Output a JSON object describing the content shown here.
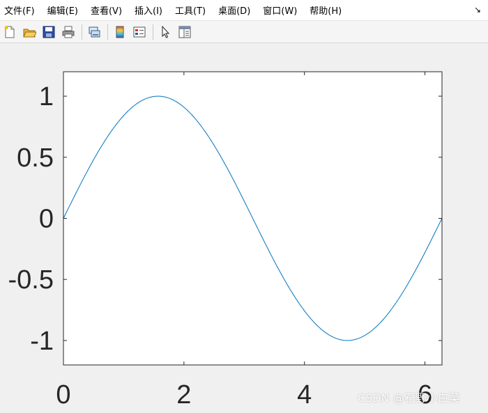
{
  "menubar": {
    "items": [
      "文件(F)",
      "编辑(E)",
      "查看(V)",
      "插入(I)",
      "工具(T)",
      "桌面(D)",
      "窗口(W)",
      "帮助(H)"
    ],
    "arrow_icon": "dock-arrow-icon"
  },
  "toolbar": {
    "icons": [
      "new-figure-icon",
      "open-file-icon",
      "save-icon",
      "print-icon",
      "link-plot-icon",
      "colorbar-icon",
      "legend-icon",
      "pointer-icon",
      "property-editor-icon"
    ]
  },
  "watermark": "CSDN @石野小白菜",
  "chart_data": {
    "type": "line",
    "function": "sin(x)",
    "xlim": [
      0,
      6.283
    ],
    "ylim": [
      -1.2,
      1.2
    ],
    "x_ticks": [
      0,
      2,
      4,
      6
    ],
    "x_tick_labels": [
      "0",
      "2",
      "4",
      "6"
    ],
    "y_ticks": [
      -1,
      -0.5,
      0,
      0.5,
      1
    ],
    "y_tick_labels": [
      "-1",
      "-0.5",
      "0",
      "0.5",
      "1"
    ],
    "series": [
      {
        "color": "#0072bd",
        "x": [
          0,
          0.3142,
          0.6283,
          0.9425,
          1.2566,
          1.5708,
          1.885,
          2.1991,
          2.5133,
          2.8274,
          3.1416,
          3.4558,
          3.7699,
          4.0841,
          4.3982,
          4.7124,
          5.0265,
          5.3407,
          5.6549,
          5.969,
          6.2832
        ],
        "y": [
          0,
          0.309,
          0.5878,
          0.809,
          0.9511,
          1,
          0.9511,
          0.809,
          0.5878,
          0.309,
          0,
          -0.309,
          -0.5878,
          -0.809,
          -0.9511,
          -1,
          -0.9511,
          -0.809,
          -0.5878,
          -0.309,
          0
        ]
      }
    ],
    "grid": false,
    "title": "",
    "xlabel": "",
    "ylabel": ""
  }
}
